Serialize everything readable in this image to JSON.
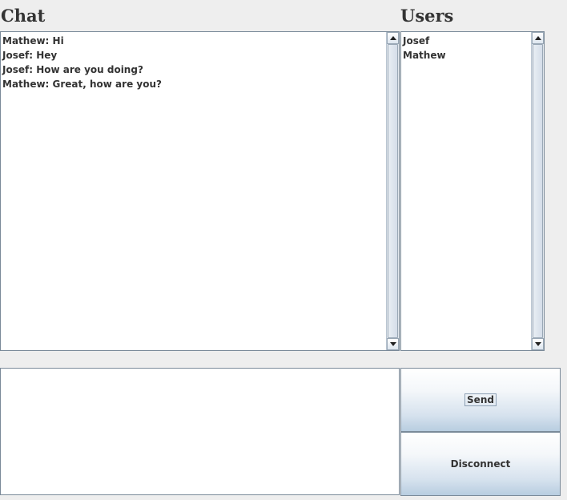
{
  "chat": {
    "heading": "Chat",
    "messages": [
      "Mathew: Hi",
      "Josef: Hey",
      "Josef: How are you doing?",
      "Mathew: Great, how are you?"
    ]
  },
  "users": {
    "heading": "Users",
    "list": [
      "Josef",
      "Mathew"
    ]
  },
  "composer": {
    "message_value": ""
  },
  "buttons": {
    "send_label": "Send",
    "disconnect_label": "Disconnect"
  },
  "icons": {
    "scroll_up": "chevron-up-icon",
    "scroll_down": "chevron-down-icon"
  }
}
